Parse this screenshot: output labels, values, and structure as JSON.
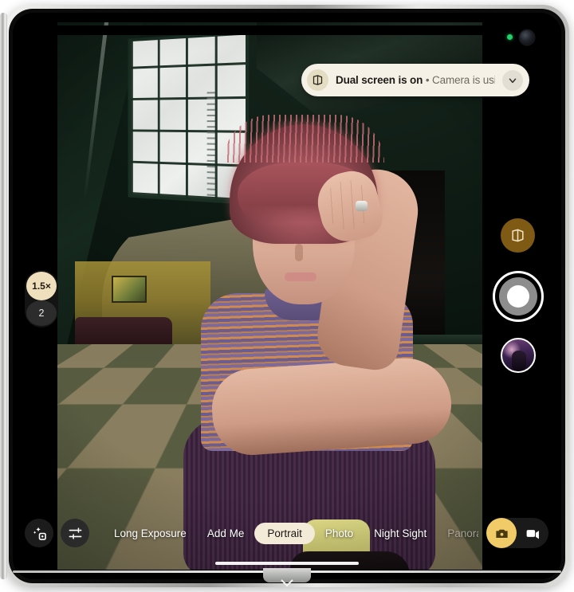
{
  "device": {
    "name": "foldable-phone",
    "frame_color": "#cfd0cd"
  },
  "status": {
    "privacy_dot": {
      "name": "camera-in-use-indicator",
      "color": "#21d16b"
    }
  },
  "banner": {
    "icon": "dual-screen-fold-icon",
    "title": "Dual screen is on",
    "separator": " • ",
    "detail": "Camera is using b...",
    "chevron": "chevron-down-icon"
  },
  "zoom_control": {
    "name": "zoom-level-selector",
    "options": [
      {
        "label": "1.5×",
        "selected": true
      },
      {
        "label": "2",
        "selected": false
      }
    ]
  },
  "right_controls": {
    "dual_screen_toggle": {
      "label": "dual-screen-toggle",
      "color": "#7e5a14"
    },
    "shutter": {
      "label": "shutter-button"
    },
    "gallery_thumbnail": {
      "label": "last-photo-thumbnail"
    }
  },
  "bottom_bar": {
    "lens_button": "ai-lens-icon",
    "settings_button": "camera-settings-icon",
    "modes": [
      {
        "label": "Long Exposure",
        "state": "normal"
      },
      {
        "label": "Add Me",
        "state": "normal"
      },
      {
        "label": "Portrait",
        "state": "active"
      },
      {
        "label": "Photo",
        "state": "normal"
      },
      {
        "label": "Night Sight",
        "state": "normal"
      },
      {
        "label": "Panora",
        "state": "dim"
      }
    ],
    "capture_toggle": {
      "photo": {
        "label": "photo-mode",
        "selected": true,
        "color": "#f0cb67"
      },
      "video": {
        "label": "video-mode",
        "selected": false
      }
    }
  },
  "viewfinder": {
    "name": "camera-viewfinder",
    "scene": "Portrait of a person with pink-auburn hair crouching on a green and tan checkerboard floor in a dark green stairwell with a large frosted glass window"
  },
  "home_indicator": {
    "name": "gesture-home-indicator"
  }
}
